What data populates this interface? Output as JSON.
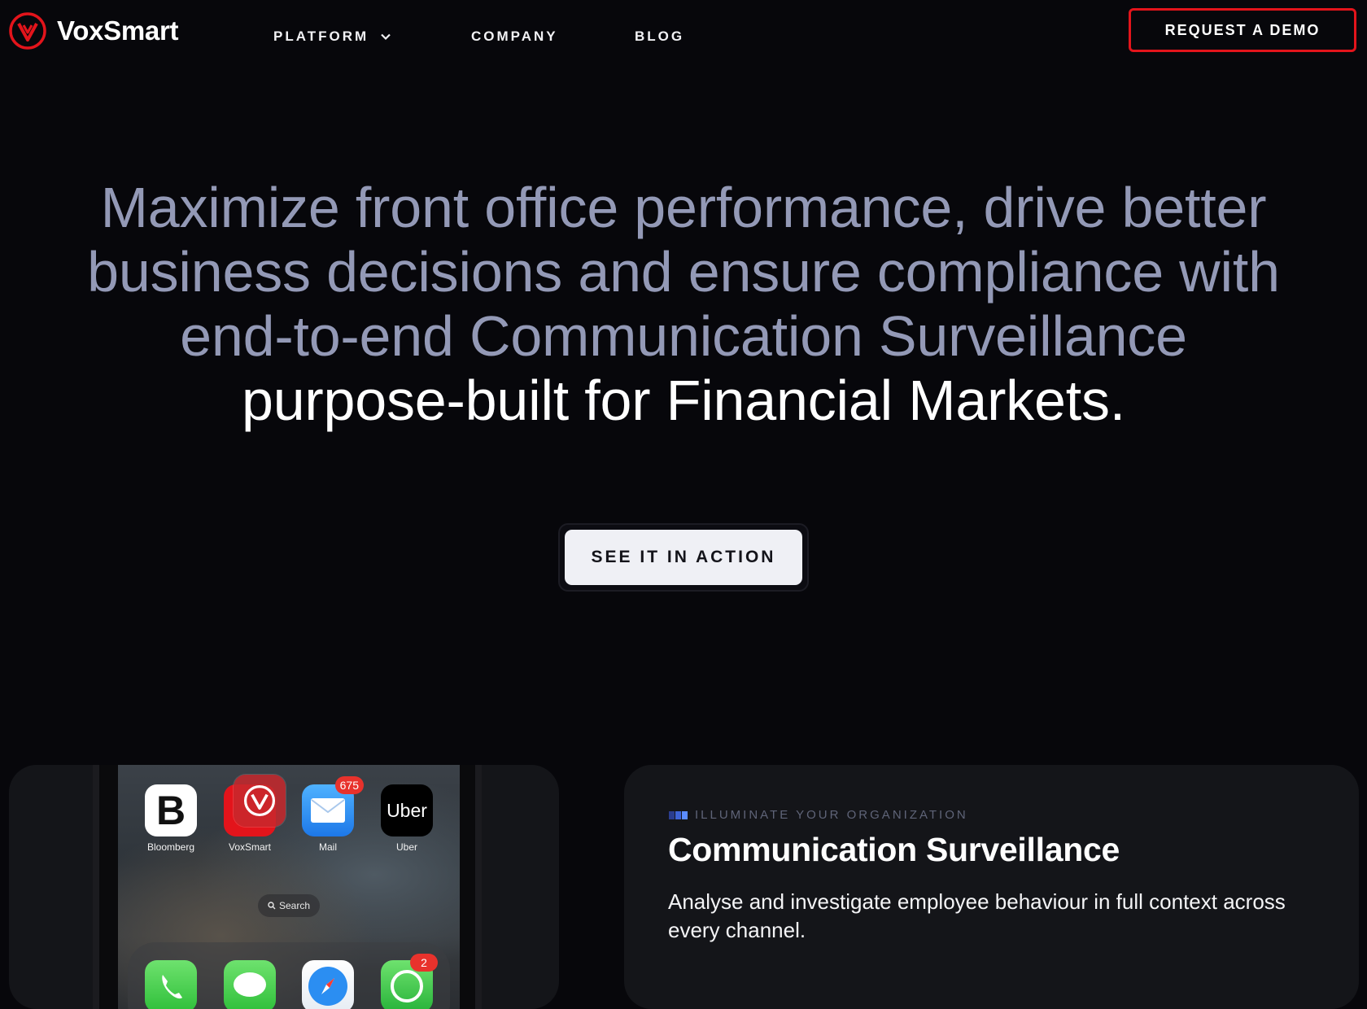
{
  "brand": {
    "name": "VoxSmart",
    "accent": "#e3141b"
  },
  "nav": {
    "items": [
      {
        "label": "PLATFORM",
        "has_dropdown": true,
        "icon": "chevron-down-icon"
      },
      {
        "label": "COMPANY"
      },
      {
        "label": "BLOG"
      }
    ],
    "cta_label": "REQUEST A DEMO"
  },
  "hero": {
    "line1": "Maximize front office performance, drive better",
    "line2": "business decisions and ensure compliance with",
    "line3": "end-to-end Communication Surveillance",
    "line4": "purpose-built for Financial Markets.",
    "cta_label": "SEE IT IN ACTION"
  },
  "phone": {
    "apps": [
      {
        "label": "Bloomberg",
        "glyph": "B"
      },
      {
        "label": "VoxSmart"
      },
      {
        "label": "Mail",
        "badge": "675"
      },
      {
        "label": "Uber",
        "glyph": "Uber"
      }
    ],
    "search_label": "Search",
    "dock_badge": "2"
  },
  "feature": {
    "eyebrow": "ILLUMINATE YOUR ORGANIZATION",
    "title": "Communication Surveillance",
    "description": "Analyse and investigate employee behaviour in full context across every channel."
  }
}
